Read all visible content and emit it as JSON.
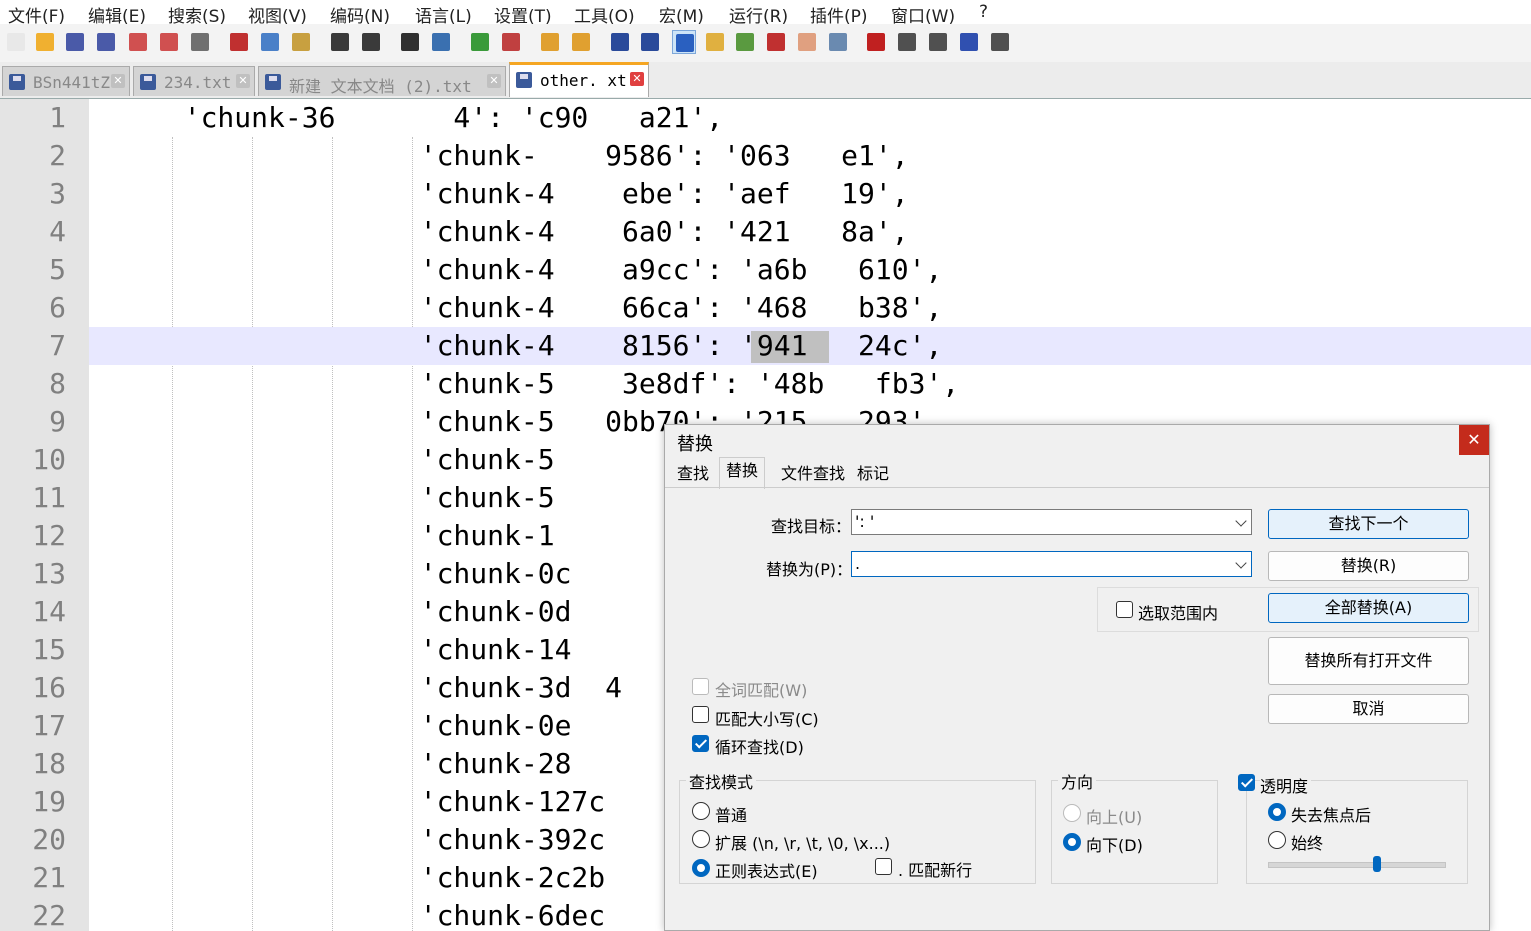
{
  "menu": [
    "文件(F)",
    "编辑(E)",
    "搜索(S)",
    "视图(V)",
    "编码(N)",
    "语言(L)",
    "设置(T)",
    "工具(O)",
    "宏(M)",
    "运行(R)",
    "插件(P)",
    "窗口(W)",
    "?"
  ],
  "toolbar_icons": [
    "new-file-icon",
    "open-file-icon",
    "save-icon",
    "save-all-icon",
    "close-icon",
    "close-all-icon",
    "print-icon",
    "cut-icon",
    "copy-icon",
    "paste-icon",
    "undo-icon",
    "redo-icon",
    "find-icon",
    "replace-icon",
    "zoom-in-icon",
    "zoom-out-icon",
    "sync-vertical-icon",
    "sync-horizontal-icon",
    "word-wrap-icon",
    "show-all-chars-icon",
    "indent-guide-icon",
    "user-lang-icon",
    "doc-map-icon",
    "function-list-icon",
    "folder-workspace-icon",
    "monitoring-icon",
    "record-macro-icon",
    "stop-macro-icon",
    "play-macro-icon",
    "run-macro-multiple-icon",
    "save-macro-icon"
  ],
  "toolbar_colors": [
    "#e8e8e8",
    "#f0b030",
    "#4a5aa8",
    "#4a5aa8",
    "#d05050",
    "#d05050",
    "#707070",
    "#c03030",
    "#4a80c8",
    "#c8a040",
    "#3a3a3a",
    "#3a3a3a",
    "#303030",
    "#3a70b0",
    "#3a9a3a",
    "#c04040",
    "#e0a030",
    "#e0a030",
    "#2a4a9a",
    "#2a4a9a",
    "#2a60c0",
    "#e0b040",
    "#5a9a40",
    "#c03030",
    "#e0a080",
    "#6a8ab0",
    "#c02020",
    "#505050",
    "#505050",
    "#3050b0",
    "#505050"
  ],
  "tabs": [
    {
      "label": "BSn441tZ"
    },
    {
      "label": "234.txt"
    },
    {
      "label": "新建 文本文档 (2).txt"
    },
    {
      "label": "other.  xt"
    }
  ],
  "editor": {
    "lines": [
      {
        "n": "1",
        "text": "  'chunk-36       4': 'c90   a21',"
      },
      {
        "n": "2",
        "text": "                'chunk-    9586': '063   e1',"
      },
      {
        "n": "3",
        "text": "                'chunk-4    ebe': 'aef   19',"
      },
      {
        "n": "4",
        "text": "                'chunk-4    6a0': '421   8a',"
      },
      {
        "n": "5",
        "text": "                'chunk-4    a9cc': 'a6b   610',"
      },
      {
        "n": "6",
        "text": "                'chunk-4    66ca': '468   b38',"
      },
      {
        "n": "7",
        "text": "                'chunk-4    8156': '941   24c',"
      },
      {
        "n": "8",
        "text": "                'chunk-5    3e8df': '48b   fb3',"
      },
      {
        "n": "9",
        "text": "                'chunk-5   0bb70': '215   293',"
      },
      {
        "n": "10",
        "text": "                'chunk-5"
      },
      {
        "n": "11",
        "text": "                'chunk-5"
      },
      {
        "n": "12",
        "text": "                'chunk-1"
      },
      {
        "n": "13",
        "text": "                'chunk-0c"
      },
      {
        "n": "14",
        "text": "                'chunk-0d"
      },
      {
        "n": "15",
        "text": "                'chunk-14"
      },
      {
        "n": "16",
        "text": "                'chunk-3d  4"
      },
      {
        "n": "17",
        "text": "                'chunk-0e"
      },
      {
        "n": "18",
        "text": "                'chunk-28"
      },
      {
        "n": "19",
        "text": "                'chunk-127c"
      },
      {
        "n": "20",
        "text": "                'chunk-392c"
      },
      {
        "n": "21",
        "text": "                'chunk-2c2b"
      },
      {
        "n": "22",
        "text": "                'chunk-6dec"
      }
    ]
  },
  "dialog": {
    "title": "替换",
    "close": "✕",
    "tabs": [
      "查找",
      "替换",
      "文件查找",
      "标记"
    ],
    "find_label": "查找目标：",
    "find_value": "': '",
    "replace_label": "替换为(P)：",
    "replace_value": ".",
    "in_selection": "选取范围内",
    "buttons": {
      "find_next": "查找下一个",
      "replace": "替换(R)",
      "replace_all": "全部替换(A)",
      "replace_all_open": "替换所有打开文件",
      "cancel": "取消"
    },
    "options": {
      "whole_word": "全词匹配(W)",
      "match_case": "匹配大小写(C)",
      "wrap_around": "循环查找(D)"
    },
    "search_mode": {
      "title": "查找模式",
      "normal": "普通",
      "extended": "扩展 (\\n, \\r, \\t, \\0, \\x...)",
      "regex": "正则表达式(E)",
      "dot_newline": ". 匹配新行"
    },
    "direction": {
      "title": "方向",
      "up": "向上(U)",
      "down": "向下(D)"
    },
    "transparency": {
      "title": "透明度",
      "on_lose_focus": "失去焦点后",
      "always": "始终",
      "level": 0.62
    }
  }
}
